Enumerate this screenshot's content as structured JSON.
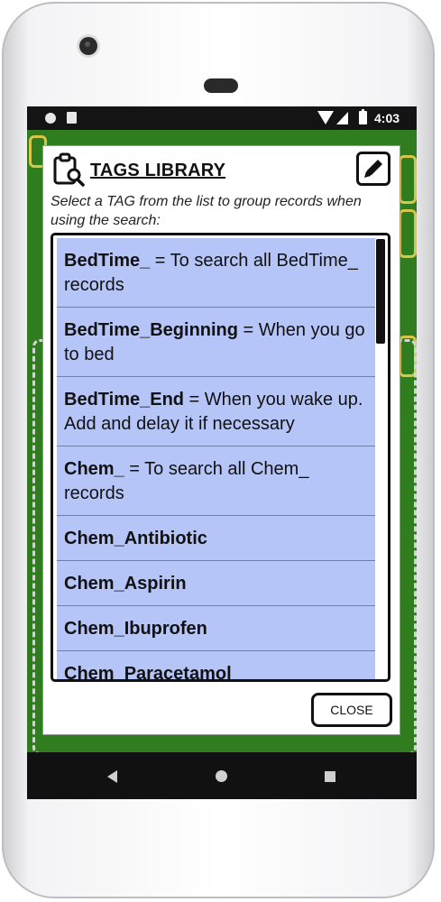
{
  "status_bar": {
    "time": "4:03"
  },
  "dialog": {
    "title": "TAGS LIBRARY",
    "subtitle": "Select a TAG from the list to group records when using the search:",
    "close_label": "CLOSE",
    "tags": [
      {
        "name": "BedTime_",
        "description": " = To search all BedTime_ records"
      },
      {
        "name": "BedTime_Beginning",
        "description": " = When you go to bed"
      },
      {
        "name": "BedTime_End",
        "description": " = When you wake up. Add and delay it if necessary"
      },
      {
        "name": "Chem_",
        "description": " = To search all Chem_ records"
      },
      {
        "name": "Chem_Antibiotic",
        "description": ""
      },
      {
        "name": "Chem_Aspirin",
        "description": ""
      },
      {
        "name": "Chem_Ibuprofen",
        "description": ""
      },
      {
        "name": "Chem_Paracetamol",
        "description": ""
      }
    ]
  },
  "icons": {
    "header": "clipboard-search-icon",
    "edit": "pencil-icon",
    "nav": [
      "back-icon",
      "home-icon",
      "recents-icon"
    ]
  },
  "colors": {
    "list_item_bg": "#b6c5f8",
    "app_background": "#2f7d1e",
    "accent_dark": "#111111"
  }
}
